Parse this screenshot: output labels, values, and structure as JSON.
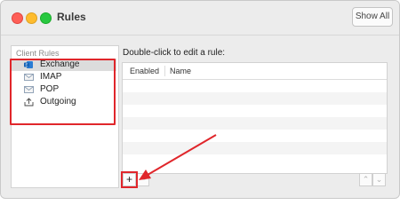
{
  "window": {
    "title": "Rules",
    "show_all_label": "Show All"
  },
  "sidebar": {
    "header": "Client Rules",
    "items": [
      {
        "label": "Exchange",
        "icon": "exchange-icon",
        "selected": true
      },
      {
        "label": "IMAP",
        "icon": "envelope-icon",
        "selected": false
      },
      {
        "label": "POP",
        "icon": "envelope-icon",
        "selected": false
      },
      {
        "label": "Outgoing",
        "icon": "outbox-icon",
        "selected": false
      }
    ]
  },
  "main": {
    "instruction": "Double-click to edit a rule:",
    "columns": [
      "Enabled",
      "Name"
    ],
    "rows": []
  },
  "toolbar": {
    "add_label": "+",
    "remove_label": "−",
    "up_label": "⌃",
    "down_label": "⌄"
  },
  "annotation": {
    "color": "#e0262b"
  }
}
